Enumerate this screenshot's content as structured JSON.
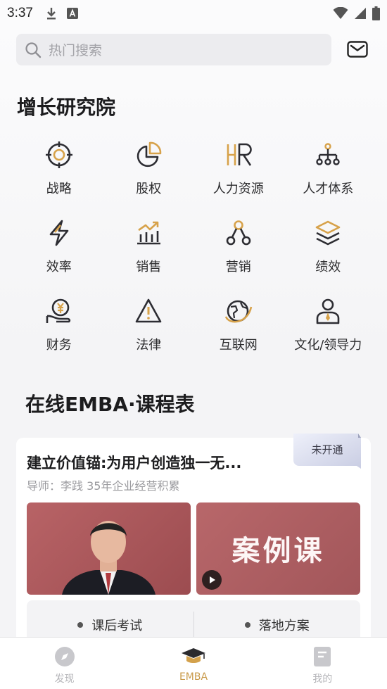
{
  "status_bar": {
    "time": "3:37",
    "icons_left": [
      "download-icon",
      "a-notification-icon"
    ],
    "icons_right": [
      "wifi-icon",
      "signal-icon",
      "battery-icon"
    ]
  },
  "search": {
    "placeholder": "热门搜索"
  },
  "growth": {
    "title": "增长研究院",
    "categories": [
      {
        "label": "战略",
        "icon": "target-icon"
      },
      {
        "label": "股权",
        "icon": "pie-chart-icon"
      },
      {
        "label": "人力资源",
        "icon": "hr-icon"
      },
      {
        "label": "人才体系",
        "icon": "org-chart-icon"
      },
      {
        "label": "效率",
        "icon": "lightning-icon"
      },
      {
        "label": "销售",
        "icon": "sales-chart-icon"
      },
      {
        "label": "营销",
        "icon": "network-icon"
      },
      {
        "label": "绩效",
        "icon": "layers-icon"
      },
      {
        "label": "财务",
        "icon": "finance-icon"
      },
      {
        "label": "法律",
        "icon": "warning-icon"
      },
      {
        "label": "互联网",
        "icon": "globe-icon"
      },
      {
        "label": "文化/领导力",
        "icon": "leader-icon"
      }
    ]
  },
  "emba": {
    "title": "在线EMBA·课程表",
    "course": {
      "title": "建立价值锚:为用户创造独一无...",
      "tutor": "导师：李践 35年企业经营积累",
      "badge": "未开通",
      "case_label": "案例课",
      "actions": [
        "课后考试",
        "落地方案"
      ]
    }
  },
  "nav": {
    "items": [
      {
        "label": "发现",
        "active": false
      },
      {
        "label": "EMBA",
        "active": true
      },
      {
        "label": "我的",
        "active": false
      }
    ]
  },
  "colors": {
    "accent": "#d7a24a",
    "icon_dark": "#2d2d33",
    "active_nav": "#c99a4a"
  }
}
